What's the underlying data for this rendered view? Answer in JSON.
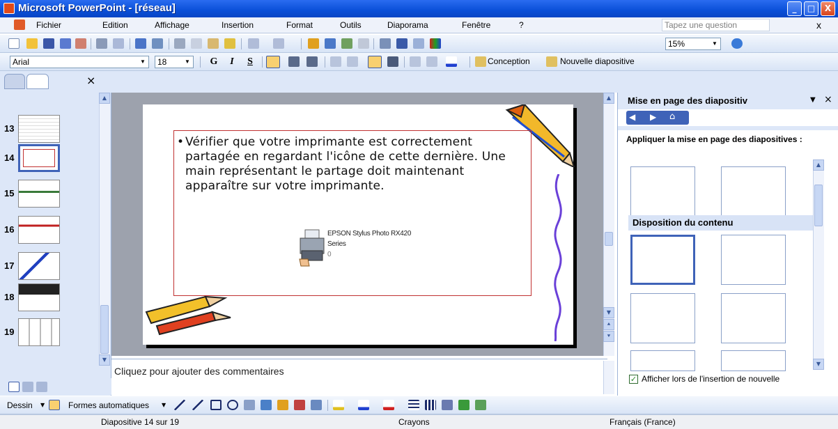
{
  "window": {
    "title": "Microsoft PowerPoint - [réseau]",
    "minimize": "_",
    "maximize": "□",
    "close": "X"
  },
  "menubar": {
    "items": [
      "Fichier",
      "Edition",
      "Affichage",
      "Insertion",
      "Format",
      "Outils",
      "Diaporama",
      "Fenêtre",
      "?"
    ],
    "help_placeholder": "Tapez une question",
    "close_doc": "x"
  },
  "standard_toolbar": {
    "zoom": "15%"
  },
  "format_toolbar": {
    "font": "Arial",
    "size": "18",
    "bold": "G",
    "italic": "I",
    "underline": "S",
    "design": "Conception",
    "new_slide": "Nouvelle diapositive"
  },
  "left_pane": {
    "close": "×",
    "slides": [
      {
        "num": "13",
        "selected": false
      },
      {
        "num": "14",
        "selected": true
      },
      {
        "num": "15",
        "selected": false
      },
      {
        "num": "16",
        "selected": false
      },
      {
        "num": "17",
        "selected": false
      },
      {
        "num": "18",
        "selected": false
      },
      {
        "num": "19",
        "selected": false
      }
    ]
  },
  "slide": {
    "bullet": "Vérifier que votre imprimante est correctement partagée en regardant l'icône de cette dernière. Une main représentant le partage doit maintenant apparaître sur votre imprimante.",
    "printer_name_1": "EPSON Stylus Photo RX420",
    "printer_name_2": "Series",
    "printer_status": "0"
  },
  "notes": {
    "placeholder": "Cliquez pour ajouter des commentaires"
  },
  "task_pane": {
    "title": "Mise en page des diapositiv",
    "apply_label": "Appliquer la mise en page des diapositives :",
    "section_content": "Disposition du contenu",
    "show_on_insert": "Afficher lors de l'insertion de nouvelle"
  },
  "draw_toolbar": {
    "draw": "Dessin",
    "autoshapes": "Formes automatiques"
  },
  "status_bar": {
    "slide_info": "Diapositive 14 sur 19",
    "design": "Crayons",
    "language": "Français (France)"
  },
  "colors": {
    "title_bar": "#0a4fd8",
    "selection": "#3f63b8",
    "placeholder_border": "#c03030",
    "slide_bg": "#9da2ad"
  }
}
